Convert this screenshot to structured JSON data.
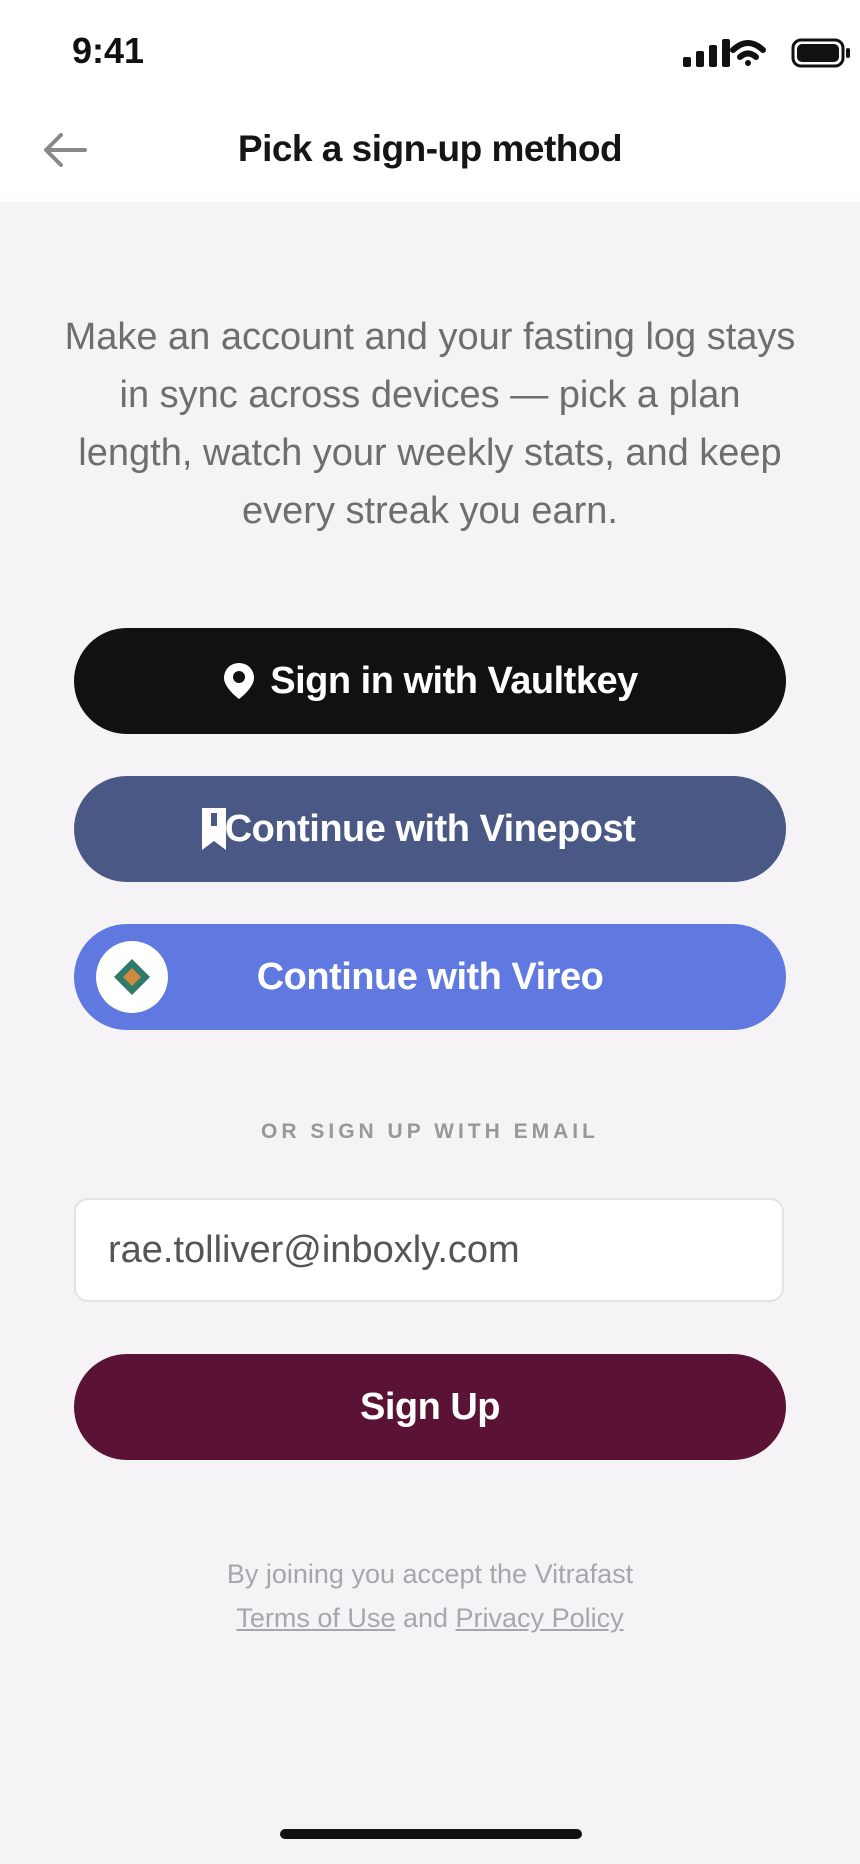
{
  "status_bar": {
    "time": "9:41"
  },
  "nav": {
    "title": "Pick a sign-up method"
  },
  "intro": "Make an account and your fasting log stays in sync across devices — pick a plan length, watch your weekly stats, and keep every streak you earn.",
  "providers": [
    {
      "label": "Sign in with Vaultkey",
      "icon": "location-pin-icon",
      "color": "#111114"
    },
    {
      "label": "Continue with Vinepost",
      "icon": "bookmark-icon",
      "color": "#4a5886"
    },
    {
      "label": "Continue with Vireo",
      "icon": "diamond-logo-icon",
      "color": "#6079e0"
    }
  ],
  "divider": "OR SIGN UP WITH EMAIL",
  "email": {
    "value": "rae.tolliver@inboxly.com"
  },
  "signup": {
    "label": "Sign Up",
    "color": "#5b1335"
  },
  "legal": {
    "prefix": "By joining you accept the Vitrafast",
    "terms": "Terms of Use",
    "conjunction": "and",
    "privacy": "Privacy Policy"
  }
}
